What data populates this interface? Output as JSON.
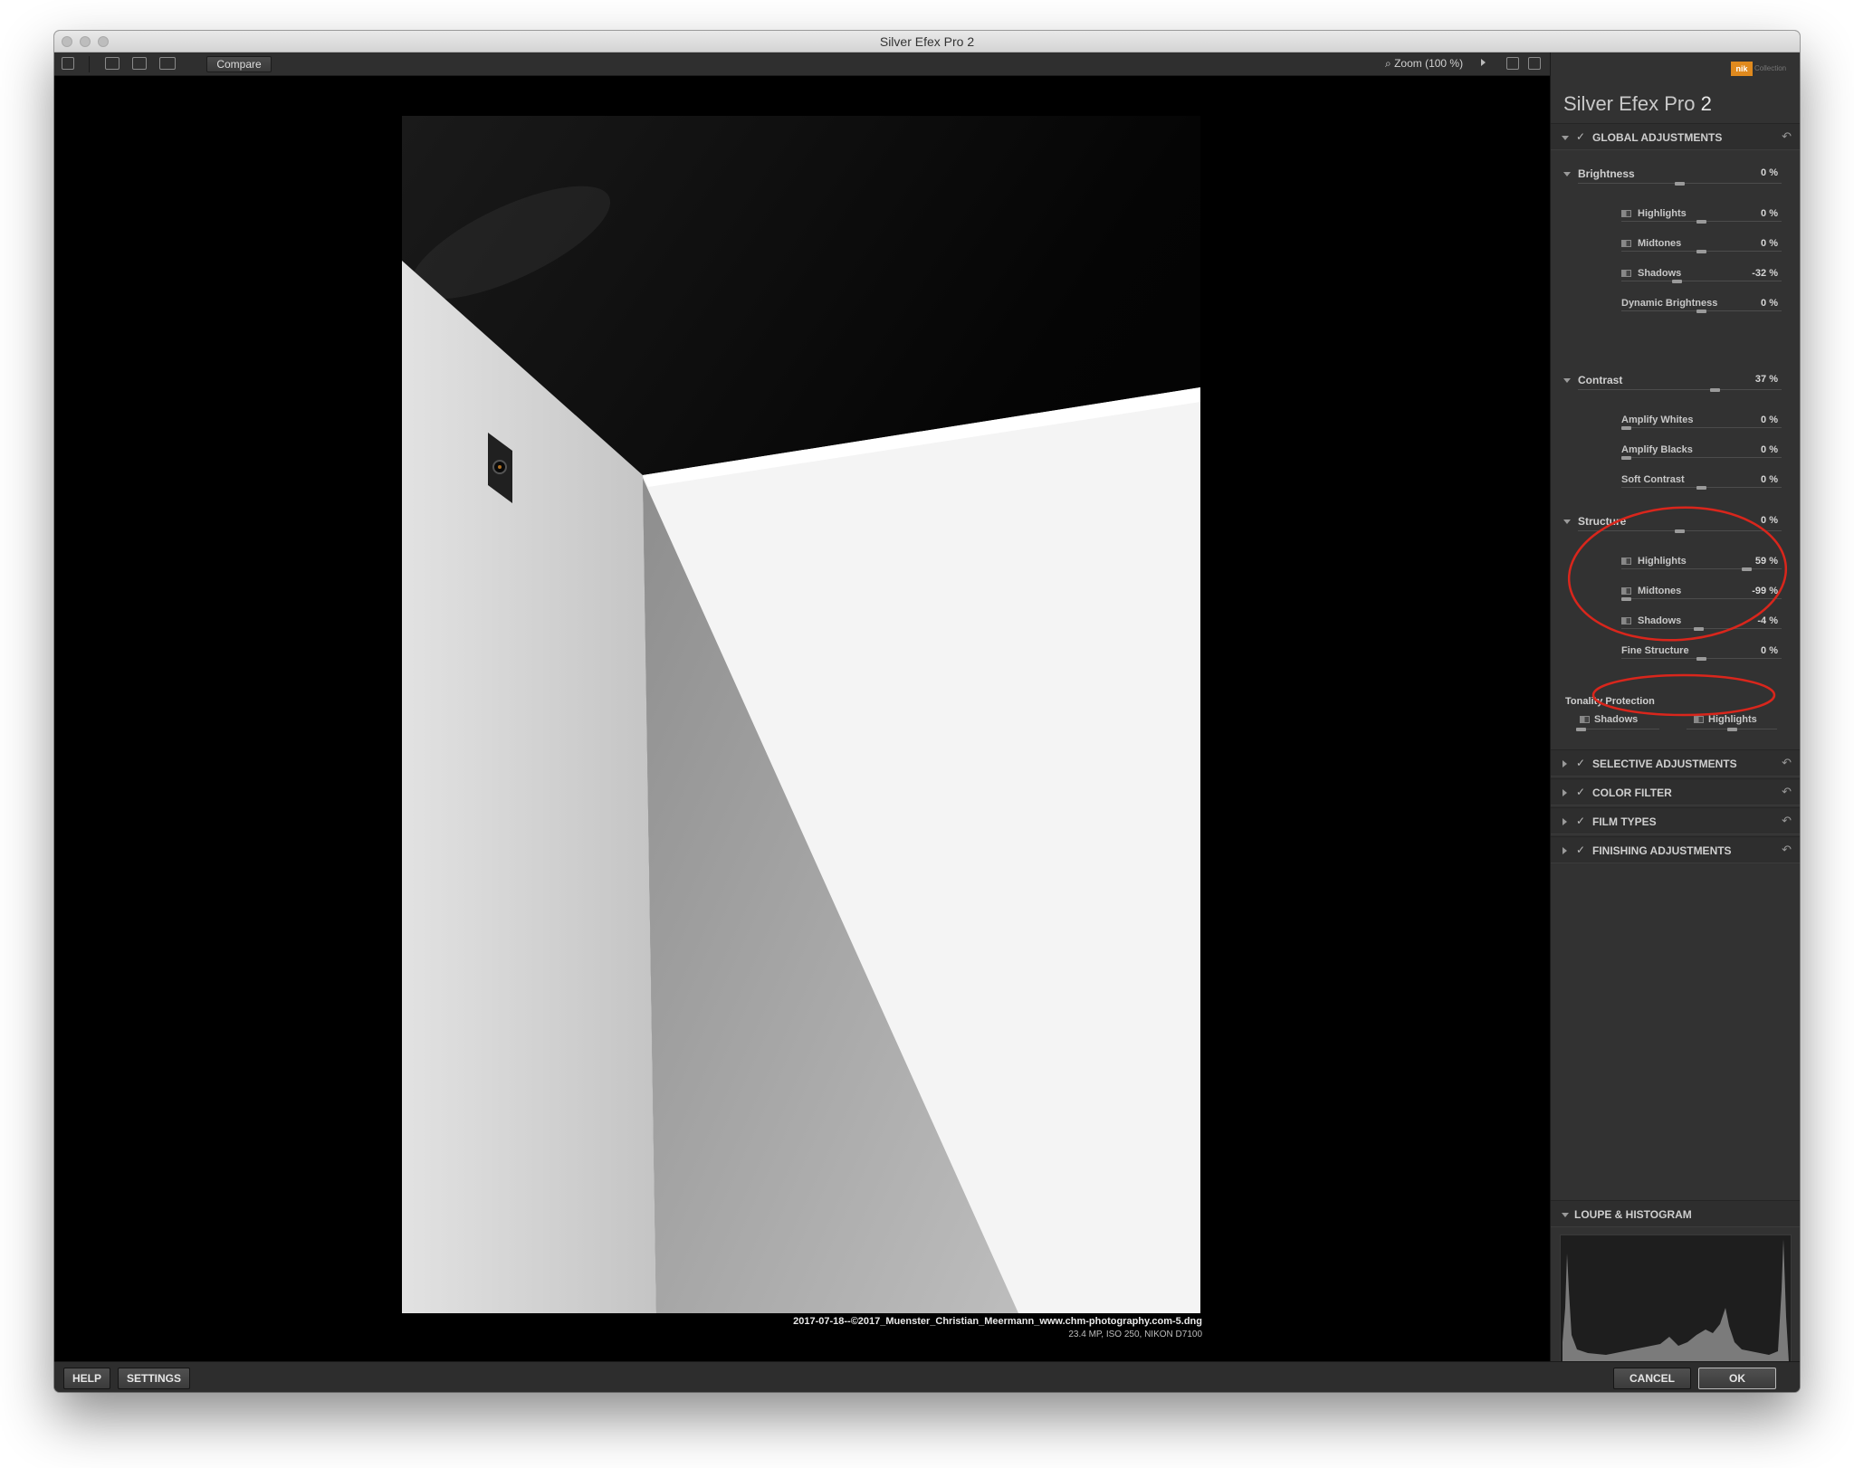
{
  "window": {
    "title": "Silver Efex Pro 2"
  },
  "toolbar": {
    "compare_label": "Compare",
    "zoom_label": "Zoom (100 %)"
  },
  "image_info": {
    "filename": "2017-07-18--©2017_Muenster_Christian_Meermann_www.chm-photography.com-5.dng",
    "meta": "23.4 MP, ISO 250, NIKON D7100"
  },
  "bottom": {
    "help": "HELP",
    "settings": "SETTINGS",
    "cancel": "CANCEL",
    "ok": "OK"
  },
  "panel": {
    "logo_text": "nik",
    "logo_suffix": "Collection",
    "title": "Silver Efex Pro",
    "title_number": "2",
    "global_adjustments": "GLOBAL ADJUSTMENTS",
    "brightness": {
      "label": "Brightness",
      "value": "0 %",
      "level": 0.5
    },
    "brightness_rows": [
      {
        "label": "Highlights",
        "value": "0 %",
        "level": 0.5
      },
      {
        "label": "Midtones",
        "value": "0 %",
        "level": 0.5
      },
      {
        "label": "Shadows",
        "value": "-32 %",
        "level": 0.34
      },
      {
        "label": "Dynamic Brightness",
        "value": "0 %",
        "level": 0.5
      }
    ],
    "contrast": {
      "label": "Contrast",
      "value": "37 %",
      "level": 0.68
    },
    "contrast_rows": [
      {
        "label": "Amplify Whites",
        "value": "0 %",
        "level": 0.0
      },
      {
        "label": "Amplify Blacks",
        "value": "0 %",
        "level": 0.0
      },
      {
        "label": "Soft Contrast",
        "value": "0 %",
        "level": 0.5
      }
    ],
    "structure": {
      "label": "Structure",
      "value": "0 %",
      "level": 0.5
    },
    "structure_rows": [
      {
        "label": "Highlights",
        "value": "59 %",
        "level": 0.8
      },
      {
        "label": "Midtones",
        "value": "-99 %",
        "level": 0.0
      },
      {
        "label": "Shadows",
        "value": "-4 %",
        "level": 0.48
      },
      {
        "label": "Fine Structure",
        "value": "0 %",
        "level": 0.5
      }
    ],
    "tonality": {
      "label": "Tonality Protection",
      "shadows": "Shadows",
      "highlights": "Highlights",
      "shadows_level": 0.0,
      "highlights_level": 0.5
    },
    "sections": [
      "SELECTIVE ADJUSTMENTS",
      "COLOR FILTER",
      "FILM TYPES",
      "FINISHING ADJUSTMENTS"
    ],
    "loupe": "LOUPE & HISTOGRAM"
  },
  "annotations": {
    "circle_color": "#d9261c"
  }
}
